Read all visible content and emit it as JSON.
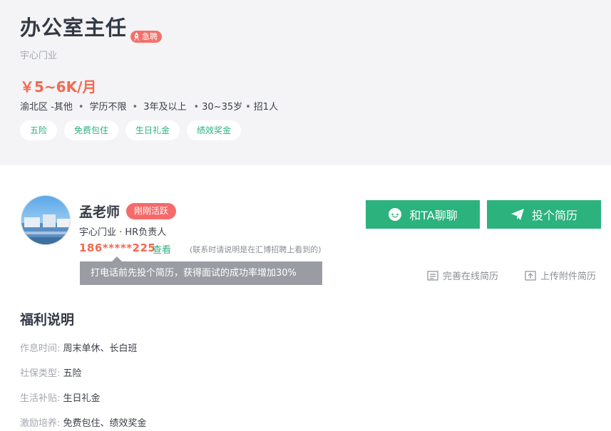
{
  "job": {
    "title": "办公室主任",
    "urgent_label": "急聘",
    "company": "宇心门业",
    "salary": "￥5~6K/月",
    "requirements": [
      "渝北区 -其他",
      "学历不限",
      "3年及以上",
      "30~35岁",
      "招1人"
    ],
    "tags": [
      "五险",
      "免费包住",
      "生日礼金",
      "绩效奖金"
    ]
  },
  "recruiter": {
    "name": "孟老师",
    "active_badge": "刚刚活跃",
    "role": "宇心门业 · HR负责人",
    "phone_masked": "186*****225",
    "view_label": "查看",
    "phone_note": "(联系时请说明是在汇博招聘上看到的)",
    "tooltip": "打电话前先投个简历，获得面试的成功率增加30%"
  },
  "actions": {
    "chat_label": "和TA聊聊",
    "apply_label": "投个简历",
    "online_resume_label": "完善在线简历",
    "upload_resume_label": "上传附件简历"
  },
  "benefits": {
    "title": "福利说明",
    "rows": [
      {
        "key": "作息时间:",
        "value": "周末单休、长白班"
      },
      {
        "key": "社保类型:",
        "value": "五险"
      },
      {
        "key": "生活补贴:",
        "value": "生日礼金"
      },
      {
        "key": "激励培养:",
        "value": "免费包住、绩效奖金"
      }
    ]
  },
  "colors": {
    "accent_green": "#2bb27d",
    "salary_orange": "#f4694f",
    "badge_red": "#f56a6a",
    "header_bg": "#f4f4f7"
  },
  "icons": {
    "urgent": "rocket-icon",
    "chat": "chat-bubble-icon",
    "apply": "paper-plane-icon",
    "online_resume": "document-icon",
    "upload_resume": "upload-icon"
  }
}
